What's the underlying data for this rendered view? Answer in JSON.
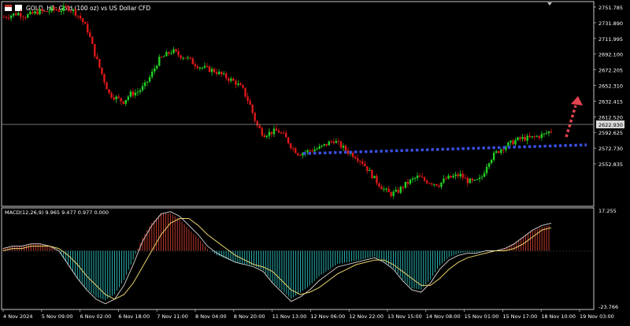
{
  "header": {
    "title": "GOLD, H1:  Gold (100 oz) vs US Dollar CFD",
    "icon": "chart-window-icon"
  },
  "price_axis": {
    "labels": [
      "2751.785",
      "2731.890",
      "2711.995",
      "2692.100",
      "2672.205",
      "2652.310",
      "2632.415",
      "2612.520",
      "2592.625",
      "2572.730",
      "2552.835"
    ],
    "current_price": "2622.930"
  },
  "macd": {
    "label": "MACD(12,26,9) 9.965 9.477 0.977 0.000",
    "axis_top": "17.255",
    "axis_bottom": "-23.766"
  },
  "time_axis": {
    "labels": [
      "4 Nov 2024",
      "5 Nov 09:00",
      "6 Nov 02:00",
      "6 Nov 18:00",
      "7 Nov 11:00",
      "8 Nov 04:00",
      "8 Nov 20:00",
      "11 Nov 13:00",
      "12 Nov 06:00",
      "12 Nov 22:00",
      "13 Nov 15:00",
      "14 Nov 08:00",
      "15 Nov 01:00",
      "15 Nov 17:00",
      "18 Nov 10:00",
      "19 Nov 03:00"
    ]
  },
  "colors": {
    "background": "#000000",
    "bull": "#22d022",
    "bear": "#e01818",
    "support_line": "#3a4fe0",
    "projection_arrow": "#e0434f",
    "macd_signal": "#e8d26a",
    "macd_main": "#d8d8d8",
    "hist_positive": "#c0392b",
    "hist_negative": "#2ab3b3",
    "grid": "#c8c8c8"
  },
  "chart_data": {
    "type": "candlestick",
    "symbol": "GOLD",
    "timeframe": "H1",
    "x_ticks": [
      "4 Nov 2024",
      "5 Nov 09:00",
      "6 Nov 02:00",
      "6 Nov 18:00",
      "7 Nov 11:00",
      "8 Nov 04:00",
      "8 Nov 20:00",
      "11 Nov 13:00",
      "12 Nov 06:00",
      "12 Nov 22:00",
      "13 Nov 15:00",
      "14 Nov 08:00",
      "15 Nov 01:00",
      "15 Nov 17:00",
      "18 Nov 10:00",
      "19 Nov 03:00"
    ],
    "close_path": [
      2740,
      2742,
      2744,
      2741,
      2743,
      2746,
      2745,
      2748,
      2747,
      2750,
      2746,
      2738,
      2725,
      2700,
      2680,
      2660,
      2656,
      2652,
      2660,
      2662,
      2668,
      2680,
      2695,
      2700,
      2705,
      2700,
      2698,
      2692,
      2688,
      2686,
      2684,
      2680,
      2676,
      2672,
      2665,
      2650,
      2628,
      2618,
      2620,
      2622,
      2616,
      2605,
      2598,
      2600,
      2602,
      2604,
      2608,
      2612,
      2606,
      2600,
      2596,
      2590,
      2580,
      2570,
      2562,
      2556,
      2558,
      2565,
      2570,
      2574,
      2570,
      2568,
      2566,
      2572,
      2574,
      2576,
      2570,
      2568,
      2572,
      2590,
      2598,
      2604,
      2608,
      2612,
      2614,
      2614,
      2616,
      2618,
      2622
    ],
    "ylim": [
      2545,
      2756
    ],
    "macd": {
      "main": [
        1,
        2,
        2,
        3,
        3,
        2,
        0,
        -6,
        -12,
        -17,
        -21,
        -23,
        -21,
        -15,
        -6,
        4,
        11,
        16,
        17,
        15,
        11,
        7,
        2,
        -1,
        -3,
        -5,
        -6,
        -7,
        -9,
        -14,
        -18,
        -22,
        -20,
        -17,
        -13,
        -10,
        -7,
        -6,
        -5,
        -4,
        -3,
        -5,
        -8,
        -13,
        -17,
        -18,
        -14,
        -8,
        -4,
        -2,
        -1,
        -1,
        0,
        0,
        1,
        3,
        6,
        9,
        11,
        12
      ],
      "signal": [
        0,
        1,
        1,
        2,
        2,
        2,
        1,
        -2,
        -6,
        -11,
        -15,
        -19,
        -21,
        -19,
        -14,
        -7,
        0,
        7,
        12,
        14,
        14,
        11,
        7,
        4,
        1,
        -2,
        -4,
        -6,
        -7,
        -9,
        -13,
        -17,
        -19,
        -18,
        -16,
        -13,
        -10,
        -8,
        -6,
        -5,
        -4,
        -4,
        -6,
        -9,
        -12,
        -15,
        -15,
        -12,
        -8,
        -5,
        -3,
        -2,
        -1,
        0,
        0,
        1,
        3,
        6,
        9,
        10
      ],
      "ylim": [
        -23.766,
        17.255
      ]
    }
  }
}
